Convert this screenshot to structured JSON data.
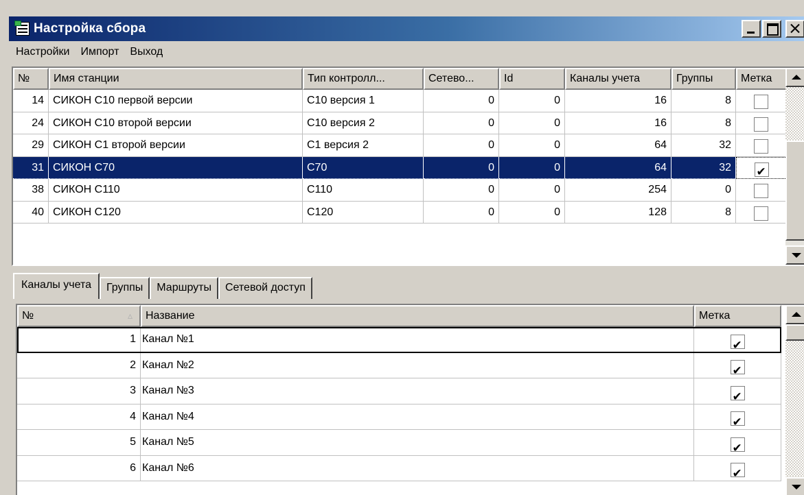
{
  "window": {
    "title": "Настройка сбора"
  },
  "menu": [
    "Настройки",
    "Импорт",
    "Выход"
  ],
  "stations": {
    "columns": [
      "№",
      "Имя станции",
      "Тип контролл...",
      "Сетево...",
      "Id",
      "Каналы учета",
      "Группы",
      "Метка"
    ],
    "rows": [
      {
        "num": "14",
        "name": "СИКОН С10 первой версии",
        "type": "С10 версия 1",
        "net": "0",
        "id": "0",
        "channels": "16",
        "groups": "8",
        "mark": false,
        "selected": false
      },
      {
        "num": "24",
        "name": "СИКОН С10 второй версии",
        "type": "С10 версия 2",
        "net": "0",
        "id": "0",
        "channels": "16",
        "groups": "8",
        "mark": false,
        "selected": false
      },
      {
        "num": "29",
        "name": "СИКОН С1 второй версии",
        "type": "С1 версия 2",
        "net": "0",
        "id": "0",
        "channels": "64",
        "groups": "32",
        "mark": false,
        "selected": false
      },
      {
        "num": "31",
        "name": "СИКОН С70",
        "type": "С70",
        "net": "0",
        "id": "0",
        "channels": "64",
        "groups": "32",
        "mark": true,
        "selected": true
      },
      {
        "num": "38",
        "name": "СИКОН С110",
        "type": "С110",
        "net": "0",
        "id": "0",
        "channels": "254",
        "groups": "0",
        "mark": false,
        "selected": false
      },
      {
        "num": "40",
        "name": "СИКОН С120",
        "type": "С120",
        "net": "0",
        "id": "0",
        "channels": "128",
        "groups": "8",
        "mark": false,
        "selected": false
      }
    ]
  },
  "tabs": [
    {
      "label": "Каналы учета",
      "active": true
    },
    {
      "label": "Группы",
      "active": false
    },
    {
      "label": "Маршруты",
      "active": false
    },
    {
      "label": "Сетевой доступ",
      "active": false
    }
  ],
  "channels": {
    "columns": [
      "№",
      "Название",
      "Метка"
    ],
    "sort_indicator": "▵",
    "rows": [
      {
        "num": "1",
        "name": "Канал №1",
        "mark": true,
        "focused": true
      },
      {
        "num": "2",
        "name": "Канал №2",
        "mark": true,
        "focused": false
      },
      {
        "num": "3",
        "name": "Канал №3",
        "mark": true,
        "focused": false
      },
      {
        "num": "4",
        "name": "Канал №4",
        "mark": true,
        "focused": false
      },
      {
        "num": "5",
        "name": "Канал №5",
        "mark": true,
        "focused": false
      },
      {
        "num": "6",
        "name": "Канал №6",
        "mark": true,
        "focused": false
      }
    ]
  },
  "colors": {
    "title_gradient_start": "#0a246a",
    "title_gradient_end": "#a6caf0",
    "selection": "#0a246a",
    "face": "#d4d0c8"
  }
}
